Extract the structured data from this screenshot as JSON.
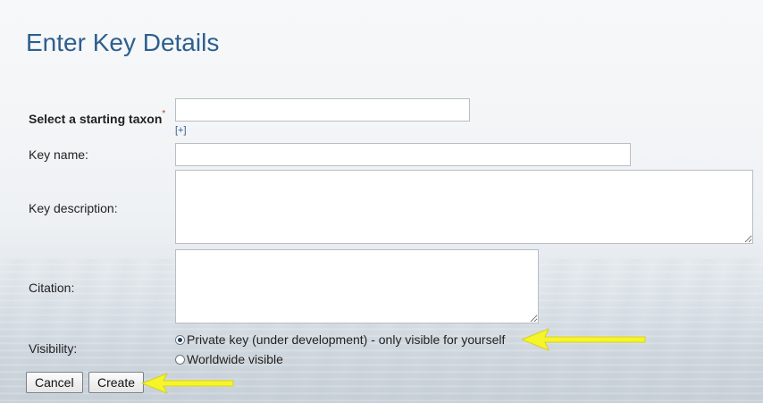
{
  "page": {
    "title": "Enter Key Details"
  },
  "form": {
    "starting_taxon": {
      "label": "Select a starting taxon",
      "required_mark": "*",
      "value": "",
      "expand_link": "[+]"
    },
    "key_name": {
      "label": "Key name:",
      "value": ""
    },
    "key_description": {
      "label": "Key description:",
      "value": ""
    },
    "citation": {
      "label": "Citation:",
      "value": ""
    },
    "visibility": {
      "label": "Visibility:",
      "options": [
        {
          "label": "Private key (under development) - only visible for yourself",
          "checked": true
        },
        {
          "label": "Worldwide visible",
          "checked": false
        }
      ]
    }
  },
  "actions": {
    "cancel_label": "Cancel",
    "create_label": "Create"
  },
  "annotation": {
    "arrow_color": "#f5f52a"
  }
}
